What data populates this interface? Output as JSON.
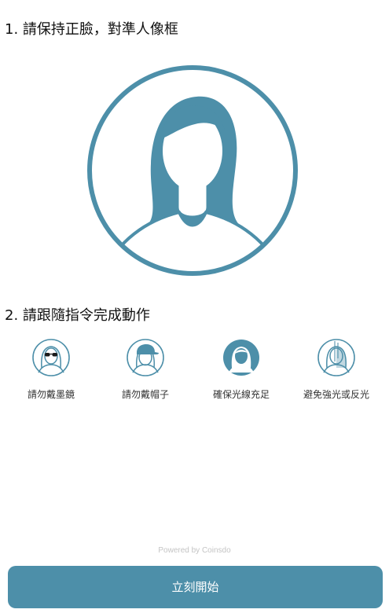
{
  "colors": {
    "accent": "#4d8fa9",
    "button_bg": "#4d8fa9",
    "button_text": "#ffffff",
    "muted_text": "#c4c4c4"
  },
  "step1": {
    "title": "1. 請保持正臉，對準人像框",
    "illustration_icon": "face-portrait-frame-icon"
  },
  "step2": {
    "title": "2. 請跟隨指令完成動作",
    "tips": [
      {
        "icon": "no-sunglasses-icon",
        "label": "請勿戴墨鏡"
      },
      {
        "icon": "no-hat-icon",
        "label": "請勿戴帽子"
      },
      {
        "icon": "good-lighting-icon",
        "label": "確保光線充足"
      },
      {
        "icon": "avoid-glare-icon",
        "label": "避免強光或反光"
      }
    ]
  },
  "footer": {
    "powered_by": "Powered by Coinsdo",
    "start_button_label": "立刻開始"
  }
}
